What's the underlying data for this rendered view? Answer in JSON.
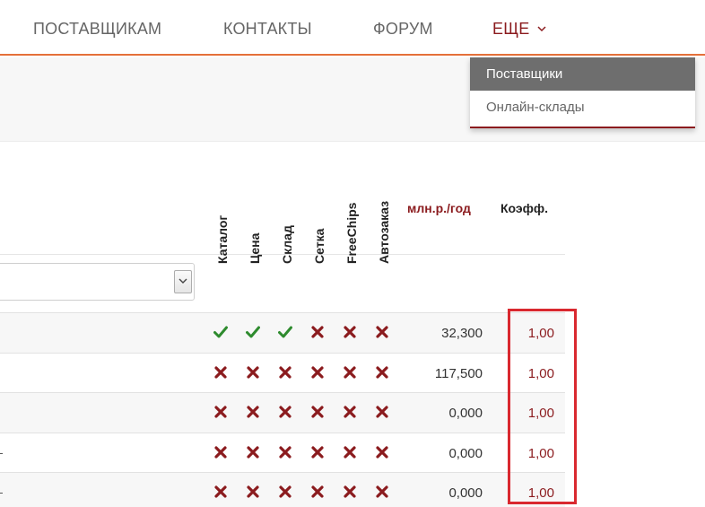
{
  "nav": {
    "items": [
      "ПОСТАВЩИКАМ",
      "КОНТАКТЫ",
      "ФОРУМ"
    ],
    "more_label": "ЕЩЕ"
  },
  "dropdown": {
    "items": [
      "Поставщики",
      "Онлайн-склады"
    ]
  },
  "table": {
    "feature_headers": [
      "Каталог",
      "Цена",
      "Склад",
      "Сетка",
      "FreeChips",
      "Автозаказ"
    ],
    "volume_header": "млн.р./год",
    "coef_header": "Коэфф.",
    "rows": [
      {
        "flags": [
          true,
          true,
          true,
          false,
          false,
          false
        ],
        "volume": "32,300",
        "coef": "1,00"
      },
      {
        "flags": [
          false,
          false,
          false,
          false,
          false,
          false
        ],
        "volume": "117,500",
        "coef": "1,00"
      },
      {
        "flags": [
          false,
          false,
          false,
          false,
          false,
          false
        ],
        "volume": "0,000",
        "coef": "1,00"
      },
      {
        "flags": [
          false,
          false,
          false,
          false,
          false,
          false
        ],
        "volume": "0,000",
        "coef": "1,00"
      },
      {
        "flags": [
          false,
          false,
          false,
          false,
          false,
          false
        ],
        "volume": "0,000",
        "coef": "1,00"
      }
    ]
  },
  "colors": {
    "accent": "#8b1b1e",
    "nav_border": "#e4703a",
    "check": "#2e8b2e",
    "cross": "#8b1b1e",
    "highlight": "#d9282f"
  },
  "icons": {
    "check": "check-icon",
    "cross": "cross-icon",
    "chevron": "chevron-down-icon"
  }
}
